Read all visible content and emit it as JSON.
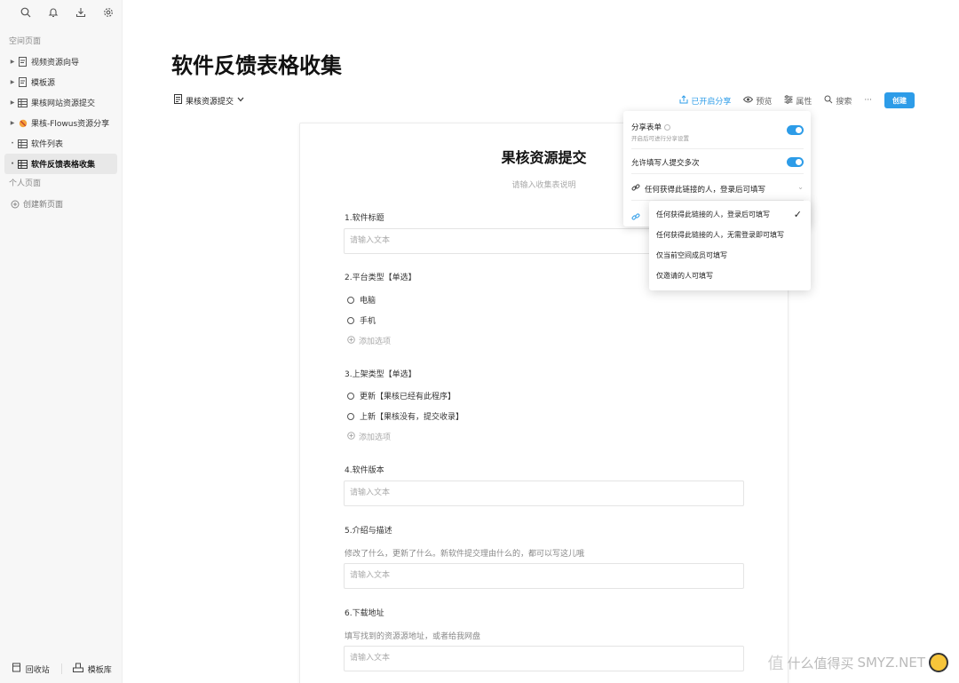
{
  "sidebar": {
    "section_space": "空间页面",
    "items": [
      {
        "label": "视频资源向导",
        "icon": "doc-icon"
      },
      {
        "label": "模板源",
        "icon": "doc-icon"
      },
      {
        "label": "果核网站资源提交",
        "icon": "table-icon"
      },
      {
        "label": "果核-Flowus资源分享",
        "icon": "prohibit-icon"
      },
      {
        "label": "软件列表",
        "icon": "table-icon"
      },
      {
        "label": "软件反馈表格收集",
        "icon": "table-icon"
      }
    ],
    "section_personal": "个人页面",
    "create_page": "创建新页面",
    "trash": "回收站",
    "templates": "模板库"
  },
  "page": {
    "title": "软件反馈表格收集",
    "view_name": "果核资源提交"
  },
  "toolbar": {
    "share": "已开启分享",
    "preview": "预览",
    "properties": "属性",
    "search": "搜索",
    "more": "···",
    "create": "创建"
  },
  "form": {
    "title": "果核资源提交",
    "description": "请输入收集表说明",
    "placeholder": "请输入文本",
    "add_option": "添加选项",
    "q1": {
      "label": "1.软件标题"
    },
    "q2": {
      "label": "2.平台类型【单选】",
      "options": [
        "电脑",
        "手机"
      ]
    },
    "q3": {
      "label": "3.上架类型【单选】",
      "options": [
        "更新【果核已经有此程序】",
        "上新【果核没有，提交收录】"
      ]
    },
    "q4": {
      "label": "4.软件版本"
    },
    "q5": {
      "label": "5.介绍与描述",
      "hint": "修改了什么，更新了什么。新软件提交理由什么的，都可以写这儿哦"
    },
    "q6": {
      "label": "6.下载地址",
      "hint": "填写找到的资源源地址，或者给我网盘"
    }
  },
  "share_popover": {
    "share_form": "分享表单",
    "share_form_hint": "开启后可进行分享设置",
    "allow_multiple": "允许填写人提交多次",
    "link_permission": "任何获得此链接的人，登录后可填写"
  },
  "permission_menu": {
    "options": [
      "任何获得此链接的人，登录后可填写",
      "任何获得此链接的人，无需登录即可填写",
      "仅当前空间成员可填写",
      "仅邀请的人可填写"
    ],
    "selected_index": 0
  },
  "watermark": {
    "text1": "值",
    "text2": "什么值得买",
    "text3": "SMYZ.NET"
  },
  "colors": {
    "accent": "#2d9ce8"
  }
}
